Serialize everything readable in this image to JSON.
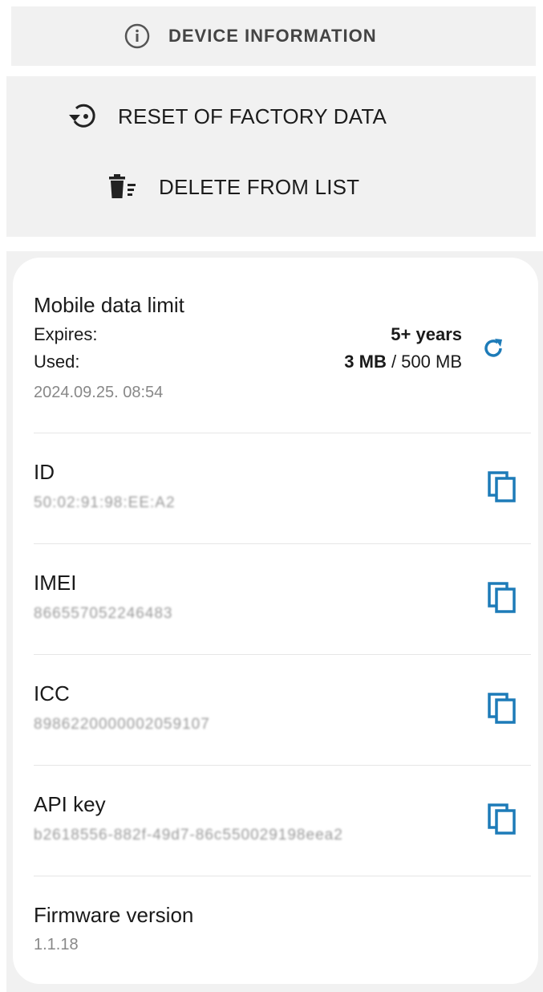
{
  "header": {
    "device_information_label": "DEVICE INFORMATION",
    "reset_label": "RESET OF FACTORY DATA",
    "delete_label": "DELETE FROM LIST"
  },
  "data_limit": {
    "title": "Mobile data limit",
    "expires_label": "Expires:",
    "expires_value": "5+ years",
    "used_label": "Used:",
    "used_value": "3 MB",
    "used_separator": " / ",
    "total_value": "500 MB",
    "timestamp": "2024.09.25. 08:54"
  },
  "fields": [
    {
      "title": "ID",
      "value": "50:02:91:98:EE:A2"
    },
    {
      "title": "IMEI",
      "value": "866557052246483"
    },
    {
      "title": "ICC",
      "value": "8986220000002059107"
    },
    {
      "title": "API key",
      "value": "b2618556-882f-49d7-86c550029198eea2"
    }
  ],
  "firmware": {
    "title": "Firmware version",
    "value": "1.1.18"
  },
  "colors": {
    "accent": "#1d7bb8",
    "panel": "#f1f1f1"
  },
  "icons": {
    "info": "info-circle-icon",
    "reset": "restore-icon",
    "delete": "delete-list-icon",
    "refresh": "refresh-icon",
    "copy": "copy-icon"
  }
}
